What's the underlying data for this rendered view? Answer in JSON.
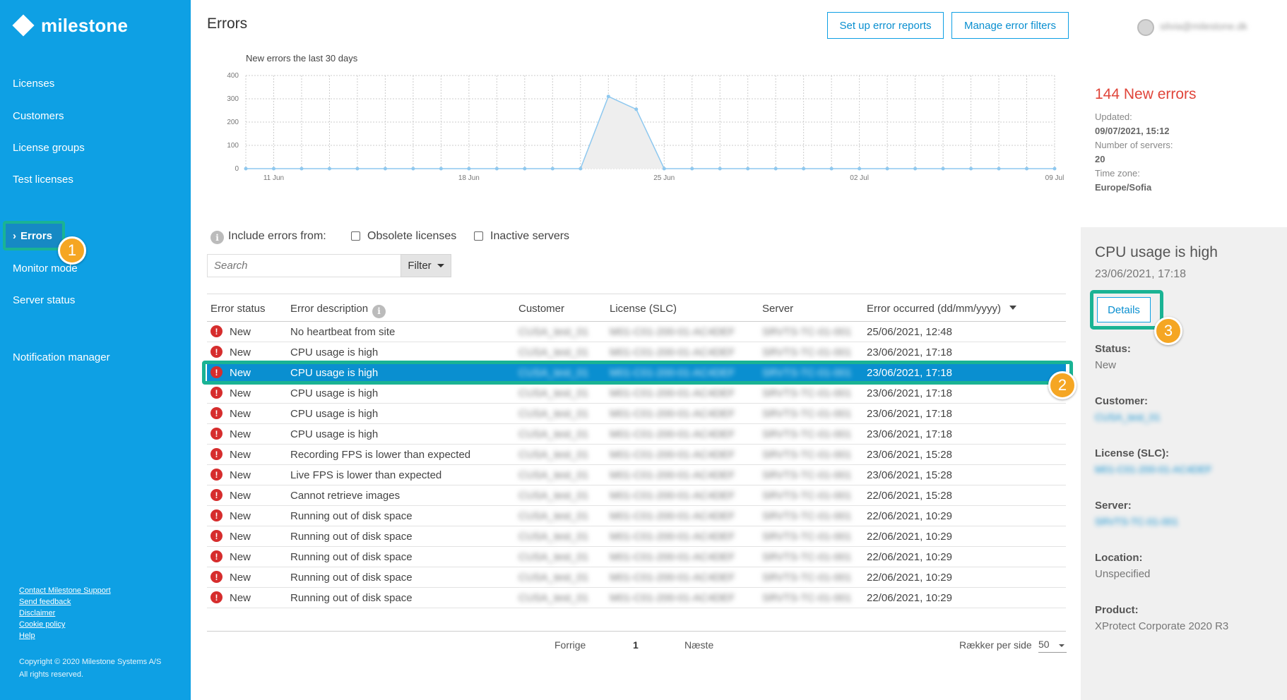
{
  "brand": {
    "name": "milestone"
  },
  "sidebar": {
    "items": [
      {
        "label": "Licenses"
      },
      {
        "label": "Customers"
      },
      {
        "label": "License groups"
      },
      {
        "label": "Test licenses"
      },
      {
        "label": "Errors",
        "active": true
      },
      {
        "label": "Monitor mode"
      },
      {
        "label": "Server status"
      },
      {
        "label": "Notification manager"
      }
    ],
    "footer_links": [
      "Contact Milestone Support",
      "Send feedback",
      "Disclaimer",
      "Cookie policy",
      "Help"
    ],
    "copyright": "Copyright © 2020 Milestone Systems A/S",
    "rights": "All rights reserved."
  },
  "callouts": [
    "1",
    "2",
    "3"
  ],
  "header": {
    "title": "Errors",
    "setup_reports_label": "Set up error reports",
    "manage_filters_label": "Manage error filters",
    "user_email": "silvia@milestone.dk"
  },
  "chart_data": {
    "type": "area",
    "title": "New errors the last 30 days",
    "x_tick_labels": [
      "11 Jun",
      "18 Jun",
      "25 Jun",
      "02 Jul",
      "09 Jul"
    ],
    "x": [
      "10 Jun",
      "11 Jun",
      "12 Jun",
      "13 Jun",
      "14 Jun",
      "15 Jun",
      "16 Jun",
      "17 Jun",
      "18 Jun",
      "19 Jun",
      "20 Jun",
      "21 Jun",
      "22 Jun",
      "23 Jun",
      "24 Jun",
      "25 Jun",
      "26 Jun",
      "27 Jun",
      "28 Jun",
      "29 Jun",
      "30 Jun",
      "01 Jul",
      "02 Jul",
      "03 Jul",
      "04 Jul",
      "05 Jul",
      "06 Jul",
      "07 Jul",
      "08 Jul",
      "09 Jul"
    ],
    "values": [
      0,
      0,
      0,
      0,
      0,
      0,
      0,
      0,
      0,
      0,
      0,
      0,
      0,
      310,
      255,
      0,
      0,
      0,
      0,
      0,
      0,
      0,
      0,
      0,
      0,
      0,
      0,
      0,
      0,
      0
    ],
    "y_ticks": [
      0,
      100,
      200,
      300,
      400
    ],
    "ylim": [
      0,
      400
    ],
    "grid": true,
    "colors": {
      "line": "#8ec8ef",
      "fill": "#eeeeee",
      "grid": "#cccccc"
    }
  },
  "summary": {
    "new_errors": "144 New errors",
    "updated_label": "Updated:",
    "updated_value": "09/07/2021, 15:12",
    "servers_label": "Number of servers:",
    "servers_value": "20",
    "timezone_label": "Time zone:",
    "timezone_value": "Europe/Sofia"
  },
  "filters": {
    "include_label": "Include errors from:",
    "obsolete_label": "Obsolete licenses",
    "inactive_label": "Inactive servers",
    "search_placeholder": "Search",
    "filter_label": "Filter"
  },
  "table": {
    "headers": {
      "status": "Error status",
      "description": "Error description",
      "customer": "Customer",
      "license": "License (SLC)",
      "server": "Server",
      "occurred": "Error occurred (dd/mm/yyyy)"
    },
    "rows": [
      {
        "status": "New",
        "description": "No heartbeat from site",
        "customer": "CUSA_test_01",
        "license": "M01-C01-200-01-AC4DEF",
        "server": "SRVTS-TC-01-001",
        "occurred": "25/06/2021, 12:48"
      },
      {
        "status": "New",
        "description": "CPU usage is high",
        "customer": "CUSA_test_01",
        "license": "M01-C01-200-01-AC4DEF",
        "server": "SRVTS-TC-01-001",
        "occurred": "23/06/2021, 17:18"
      },
      {
        "status": "New",
        "description": "CPU usage is high",
        "customer": "CUSA_test_01",
        "license": "M01-C01-200-01-AC4DEF",
        "server": "SRVTS-TC-01-001",
        "occurred": "23/06/2021, 17:18",
        "selected": true
      },
      {
        "status": "New",
        "description": "CPU usage is high",
        "customer": "CUSA_test_01",
        "license": "M01-C01-200-01-AC4DEF",
        "server": "SRVTS-TC-01-001",
        "occurred": "23/06/2021, 17:18"
      },
      {
        "status": "New",
        "description": "CPU usage is high",
        "customer": "CUSA_test_01",
        "license": "M01-C01-200-01-AC4DEF",
        "server": "SRVTS-TC-01-001",
        "occurred": "23/06/2021, 17:18"
      },
      {
        "status": "New",
        "description": "CPU usage is high",
        "customer": "CUSA_test_01",
        "license": "M01-C01-200-01-AC4DEF",
        "server": "SRVTS-TC-01-001",
        "occurred": "23/06/2021, 17:18"
      },
      {
        "status": "New",
        "description": "Recording FPS is lower than expected",
        "customer": "CUSA_test_01",
        "license": "M01-C01-200-01-AC4DEF",
        "server": "SRVTS-TC-01-001",
        "occurred": "23/06/2021, 15:28"
      },
      {
        "status": "New",
        "description": "Live FPS is lower than expected",
        "customer": "CUSA_test_01",
        "license": "M01-C01-200-01-AC4DEF",
        "server": "SRVTS-TC-01-001",
        "occurred": "23/06/2021, 15:28"
      },
      {
        "status": "New",
        "description": "Cannot retrieve images",
        "customer": "CUSA_test_01",
        "license": "M01-C01-200-01-AC4DEF",
        "server": "SRVTS-TC-01-001",
        "occurred": "22/06/2021, 15:28"
      },
      {
        "status": "New",
        "description": "Running out of disk space",
        "customer": "CUSA_test_01",
        "license": "M01-C01-200-01-AC4DEF",
        "server": "SRVTS-TC-01-001",
        "occurred": "22/06/2021, 10:29"
      },
      {
        "status": "New",
        "description": "Running out of disk space",
        "customer": "CUSA_test_01",
        "license": "M01-C01-200-01-AC4DEF",
        "server": "SRVTS-TC-01-001",
        "occurred": "22/06/2021, 10:29"
      },
      {
        "status": "New",
        "description": "Running out of disk space",
        "customer": "CUSA_test_01",
        "license": "M01-C01-200-01-AC4DEF",
        "server": "SRVTS-TC-01-001",
        "occurred": "22/06/2021, 10:29"
      },
      {
        "status": "New",
        "description": "Running out of disk space",
        "customer": "CUSA_test_01",
        "license": "M01-C01-200-01-AC4DEF",
        "server": "SRVTS-TC-01-001",
        "occurred": "22/06/2021, 10:29"
      },
      {
        "status": "New",
        "description": "Running out of disk space",
        "customer": "CUSA_test_01",
        "license": "M01-C01-200-01-AC4DEF",
        "server": "SRVTS-TC-01-001",
        "occurred": "22/06/2021, 10:29"
      }
    ]
  },
  "pagination": {
    "prev_label": "Forrige",
    "page": "1",
    "next_label": "Næste",
    "rows_per_page_label": "Rækker per side",
    "rows_per_page_value": "50"
  },
  "detail": {
    "title": "CPU usage is high",
    "time": "23/06/2021, 17:18",
    "details_button": "Details",
    "status_label": "Status:",
    "status_value": "New",
    "customer_label": "Customer:",
    "customer_value": "CUSA_test_01",
    "license_label": "License (SLC):",
    "license_value": "M01-C01-200-01-AC4DEF",
    "server_label": "Server:",
    "server_value": "SRVTS-TC-01-001",
    "location_label": "Location:",
    "location_value": "Unspecified",
    "product_label": "Product:",
    "product_value": "XProtect Corporate 2020 R3"
  }
}
